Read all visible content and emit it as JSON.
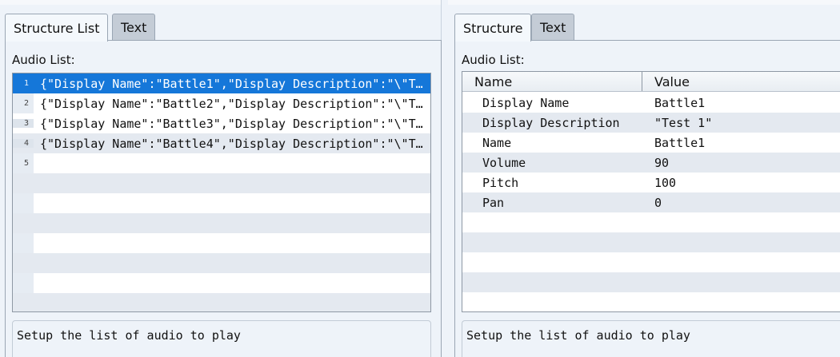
{
  "left": {
    "tabs": [
      {
        "label": "Structure List",
        "active": true
      },
      {
        "label": "Text",
        "active": false
      }
    ],
    "list_label": "Audio List:",
    "rows": [
      {
        "num": "1",
        "text": "{\"Display Name\":\"Battle1\",\"Display Description\":\"\\\"T…",
        "selected": true
      },
      {
        "num": "2",
        "text": "{\"Display Name\":\"Battle2\",\"Display Description\":\"\\\"T…",
        "selected": false
      },
      {
        "num": "3",
        "text": "{\"Display Name\":\"Battle3\",\"Display Description\":\"\\\"T…",
        "selected": false
      },
      {
        "num": "4",
        "text": "{\"Display Name\":\"Battle4\",\"Display Description\":\"\\\"T…",
        "selected": false
      },
      {
        "num": "5",
        "text": "",
        "selected": false
      }
    ],
    "description": "Setup the list of audio to play"
  },
  "right": {
    "tabs": [
      {
        "label": "Structure",
        "active": true
      },
      {
        "label": "Text",
        "active": false
      }
    ],
    "list_label": "Audio List:",
    "columns": [
      "Name",
      "Value"
    ],
    "rows": [
      {
        "name": "Display Name",
        "value": "Battle1"
      },
      {
        "name": "Display Description",
        "value": "\"Test 1\""
      },
      {
        "name": "Name",
        "value": "Battle1"
      },
      {
        "name": "Volume",
        "value": "90"
      },
      {
        "name": "Pitch",
        "value": "100"
      },
      {
        "name": "Pan",
        "value": "0"
      }
    ],
    "description": "Setup the list of audio to play"
  },
  "colors": {
    "selection": "#1577d9",
    "background": "#eef3f9",
    "alt_row": "#e4e9f0"
  }
}
